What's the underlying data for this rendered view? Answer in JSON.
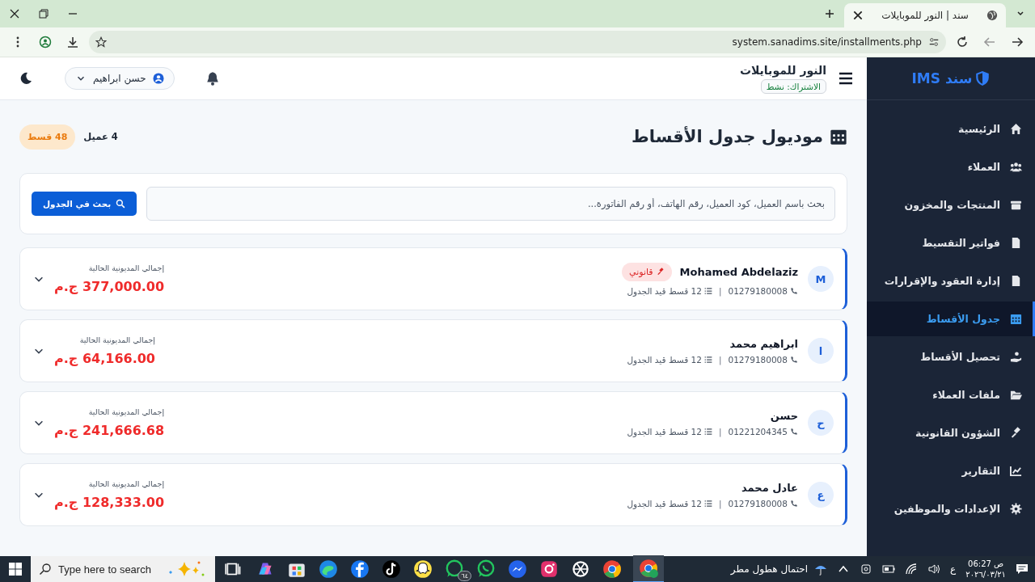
{
  "browser": {
    "tab_title": "سند | النور للموبايلات",
    "url": "system.sanadims.site/installments.php"
  },
  "header": {
    "store_name": "النور للموبايلات",
    "subscription": "الاشتراك: نشط",
    "user": "حسن ابراهيم"
  },
  "sidebar": {
    "logo": "سند IMS",
    "items": [
      {
        "label": "الرئيسية",
        "kind": "home",
        "selected": false
      },
      {
        "label": "العملاء",
        "kind": "users",
        "selected": false
      },
      {
        "label": "المنتجات والمخزون",
        "kind": "box",
        "selected": false
      },
      {
        "label": "فواتير التقسيط",
        "kind": "invoice",
        "selected": false
      },
      {
        "label": "إدارة العقود والإقرارات",
        "kind": "contract",
        "selected": false
      },
      {
        "label": "جدول الأقساط",
        "kind": "calendar",
        "selected": true
      },
      {
        "label": "تحصيل الأقساط",
        "kind": "hand",
        "selected": false
      },
      {
        "label": "ملفات العملاء",
        "kind": "folder",
        "selected": false
      },
      {
        "label": "الشؤون القانونية",
        "kind": "gavel",
        "selected": false
      },
      {
        "label": "التقارير",
        "kind": "chart",
        "selected": false
      },
      {
        "label": "الإعدادات والموظفين",
        "kind": "gear",
        "selected": false
      }
    ]
  },
  "page": {
    "title": "موديول جدول الأقساط",
    "customers_count": "4 عميل",
    "installments_badge": "48 قسط"
  },
  "search": {
    "placeholder": "بحث باسم العميل، كود العميل، رقم الهاتف، أو رقم الفاتورة...",
    "button": "بحث في الجدول"
  },
  "customers": [
    {
      "initial": "M",
      "name": "Mohamed Abdelaziz",
      "tag": "قانوني",
      "phone": "01279180008",
      "separator": "|",
      "schedule": "12 قسط قيد الجدول",
      "debt_label": "إجمالي المديونية الحالية",
      "amount": "377,000.00 ج.م"
    },
    {
      "initial": "ا",
      "name": "ابراهيم محمد",
      "phone": "01279180008",
      "separator": "|",
      "schedule": "12 قسط قيد الجدول",
      "debt_label": "إجمالي المديونية الحالية",
      "amount": "64,166.00 ج.م"
    },
    {
      "initial": "ح",
      "name": "حسن",
      "phone": "01221204345",
      "separator": "|",
      "schedule": "12 قسط قيد الجدول",
      "debt_label": "إجمالي المديونية الحالية",
      "amount": "241,666.68 ج.م"
    },
    {
      "initial": "ع",
      "name": "عادل محمد",
      "phone": "01279180008",
      "separator": "|",
      "schedule": "12 قسط قيد الجدول",
      "debt_label": "إجمالي المديونية الحالية",
      "amount": "128,333.00 ج.م"
    }
  ],
  "taskbar": {
    "search_placeholder": "Type here to search",
    "app_badge": "٦٤",
    "weather": "احتمال هطول مطر",
    "keyboard": "ع",
    "time": "06:27 ص",
    "date": "٢٠٢٦/٠٣/٢١"
  }
}
